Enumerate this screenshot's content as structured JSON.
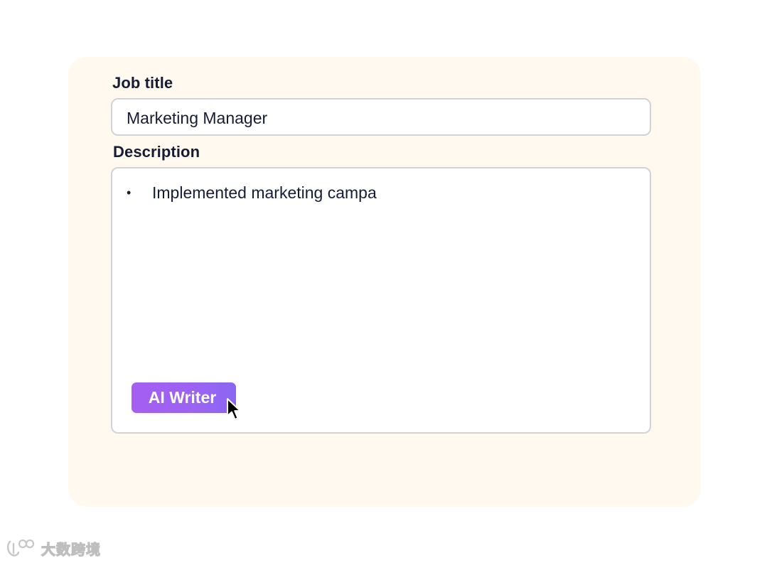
{
  "form": {
    "job_title_label": "Job title",
    "job_title_value": "Marketing Manager",
    "description_label": "Description",
    "description_bullet": "•",
    "description_items": [
      "Implemented marketing campa"
    ],
    "ai_writer_label": "AI Writer"
  },
  "watermark": {
    "text": "大数跨境"
  },
  "icons": {
    "cursor": "mouse-pointer-icon",
    "watermark_logo": "brand-logo-icon"
  },
  "colors": {
    "card_background": "#fff9ef",
    "field_border": "#d3d3d3",
    "ai_button_gradient_start": "#a45ff1",
    "ai_button_gradient_end": "#8a66f2",
    "text_primary": "#161c33"
  }
}
